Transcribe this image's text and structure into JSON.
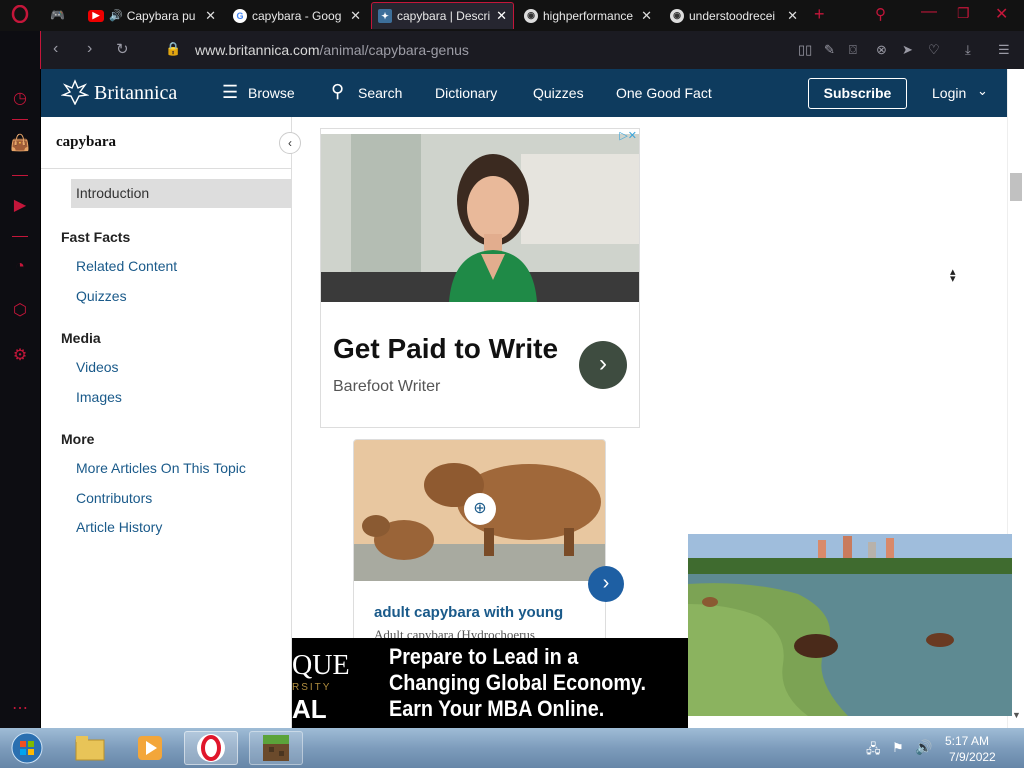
{
  "tabs": [
    {
      "label": "Capybara pu",
      "favicon": "youtube-icon"
    },
    {
      "label": "capybara - Goog",
      "favicon": "google-icon"
    },
    {
      "label": "capybara | Descri",
      "favicon": "britannica-icon",
      "active": true
    },
    {
      "label": "highperformance",
      "favicon": "globe-icon"
    },
    {
      "label": "understoodrecei",
      "favicon": "globe-icon"
    }
  ],
  "address": {
    "host": "www.britannica.com",
    "path": "/animal/capybara-genus"
  },
  "header": {
    "logo": "Britannica",
    "browse": "Browse",
    "search": "Search",
    "dictionary": "Dictionary",
    "quizzes": "Quizzes",
    "one_good_fact": "One Good Fact",
    "subscribe": "Subscribe",
    "login": "Login"
  },
  "toc": {
    "title": "capybara",
    "introduction": "Introduction",
    "fast_facts": "Fast Facts",
    "related_content": "Related Content",
    "quizzes": "Quizzes",
    "media": "Media",
    "videos": "Videos",
    "images": "Images",
    "more": "More",
    "more_articles": "More Articles On This Topic",
    "contributors": "Contributors",
    "article_history": "Article History"
  },
  "ad": {
    "title": "Get Paid to Write",
    "sponsor": "Barefoot Writer"
  },
  "image_card": {
    "title": "adult capybara with young",
    "caption": "Adult capybara (Hydrochoerus"
  },
  "banner": {
    "logo_line1": "QUE",
    "logo_line2": "RSITY",
    "logo_line3": "AL",
    "text": "Prepare to Lead in a Changing Global Economy. Earn Your MBA Online."
  },
  "taskbar": {
    "time": "5:17 AM",
    "date": "7/9/2022"
  },
  "colors": {
    "accent": "#c4163a",
    "britannica_blue": "#0e3b5e",
    "link": "#1a5a8a"
  }
}
